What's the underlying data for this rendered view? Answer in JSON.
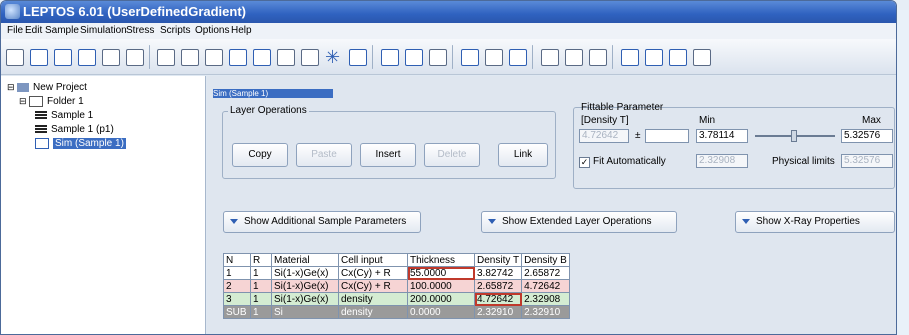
{
  "window": {
    "title": "LEPTOS 6.01 (UserDefinedGradient)"
  },
  "menu": [
    "File",
    "Edit",
    "Sample",
    "Simulation",
    "Stress",
    "Scripts",
    "Options",
    "Help"
  ],
  "tree": {
    "project": "New Project",
    "folder": "Folder 1",
    "items": [
      "Sample 1",
      "Sample 1 (p1)",
      "Sim (Sample 1)"
    ]
  },
  "panel": {
    "title": "Sim (Sample 1)",
    "layer_ops": {
      "label": "Layer Operations",
      "buttons": [
        "Copy",
        "Paste",
        "Insert",
        "Delete",
        "Link"
      ]
    },
    "fittable": {
      "label": "Fittable Parameter",
      "param": "[Density T]",
      "value": "4.72642",
      "pm": "±",
      "min_label": "Min",
      "max_label": "Max",
      "min": "3.78114",
      "max": "5.32576",
      "fit_auto": "Fit Automatically",
      "fit_value": "2.32908",
      "phys_limits": "Physical limits",
      "phys_value": "5.32576"
    },
    "toggles": [
      "Show Additional Sample Parameters",
      "Show Extended Layer Operations",
      "Show X-Ray Properties"
    ]
  },
  "grid": {
    "headers": [
      "N",
      "R",
      "Material",
      "Cell input",
      "Thickness",
      "Density T",
      "Density B"
    ],
    "rows": [
      [
        "1",
        "1",
        "Si(1-x)Ge(x)",
        "Cx(Cy) + R",
        "55.0000",
        "3.82742",
        "2.65872"
      ],
      [
        "2",
        "1",
        "Si(1-x)Ge(x)",
        "Cx(Cy) + R",
        "100.0000",
        "2.65872",
        "4.72642"
      ],
      [
        "3",
        "1",
        "Si(1-x)Ge(x)",
        "density",
        "200.0000",
        "4.72642",
        "2.32908"
      ],
      [
        "SUB",
        "1",
        "Si",
        "density",
        "0.0000",
        "2.32910",
        "2.32910"
      ]
    ]
  },
  "colors": {
    "titlebar": "#2f62c0",
    "row2": "#f6d4d4",
    "row3": "#d4ecd2",
    "sub": "#9a9a9a",
    "selected": "#3b6dc2"
  }
}
